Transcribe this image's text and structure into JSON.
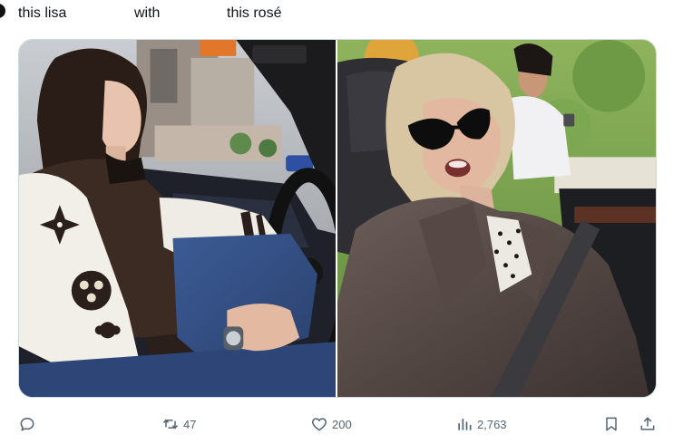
{
  "tweet": {
    "text_parts": [
      "this lisa",
      "with",
      "this rosé"
    ]
  },
  "media": {
    "images": [
      {
        "subject": "person-driving-car-photo"
      },
      {
        "subject": "person-in-convertible-photo"
      }
    ]
  },
  "actions": {
    "reply_icon": "reply-icon",
    "retweet_icon": "retweet-icon",
    "retweet_count": "47",
    "like_icon": "heart-icon",
    "like_count": "200",
    "views_icon": "views-icon",
    "views_count": "2,763",
    "bookmark_icon": "bookmark-icon",
    "share_icon": "share-icon"
  },
  "colors": {
    "text": "#0f1419",
    "muted": "#536471",
    "border": "#cfd9de"
  }
}
